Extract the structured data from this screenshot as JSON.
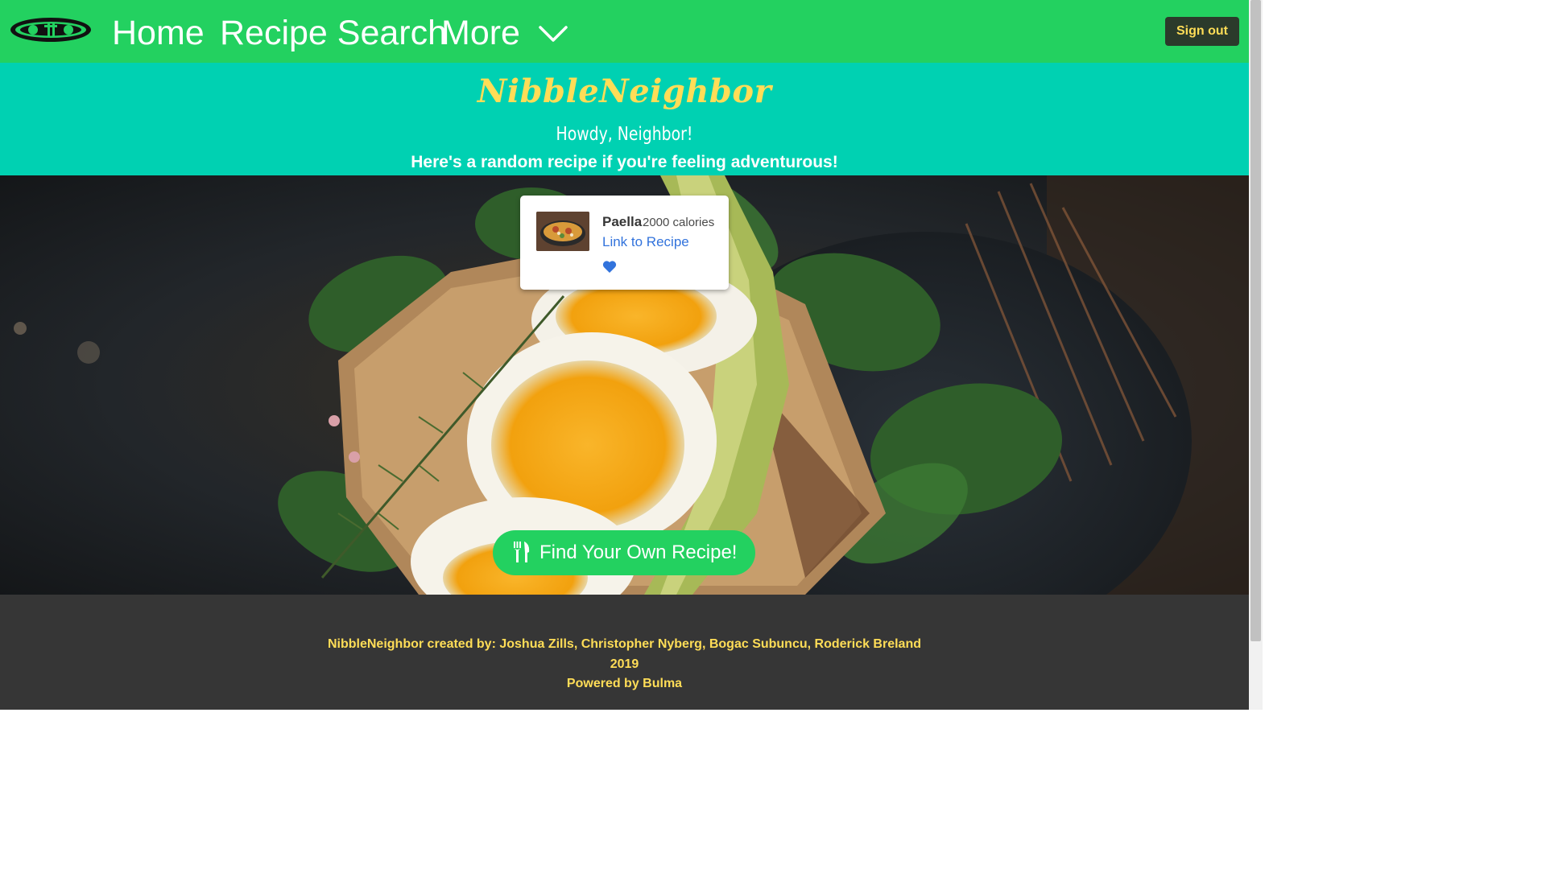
{
  "navbar": {
    "logo_icon": "plate-cutlery-icon",
    "home_label": "Home",
    "search_label": "Recipe Search",
    "more_label": "More",
    "signout_label": "Sign out"
  },
  "header": {
    "brand": "NibbleNeighbor",
    "greeting": "Howdy, Neighbor!",
    "subtitle": "Here's a random recipe if you're feeling adventurous!"
  },
  "recipe_card": {
    "name": "Paella",
    "calories": "2000 calories",
    "link_label": "Link to Recipe",
    "favorite_icon": "heart-icon"
  },
  "cta": {
    "label": "Find Your Own Recipe!",
    "icon": "utensils-icon"
  },
  "footer": {
    "credits": "NibbleNeighbor created by: Joshua Zills, Christopher Nyberg, Bogac Subuncu, Roderick Breland",
    "year": "2019",
    "powered": "Powered by Bulma"
  },
  "colors": {
    "navbar": "#23d160",
    "header": "#00d1b2",
    "brand": "#ffdd57",
    "link": "#3273dc",
    "footer_bg": "#363636",
    "footer_text": "#ffdd57",
    "signout_bg": "#2b3a2b"
  }
}
